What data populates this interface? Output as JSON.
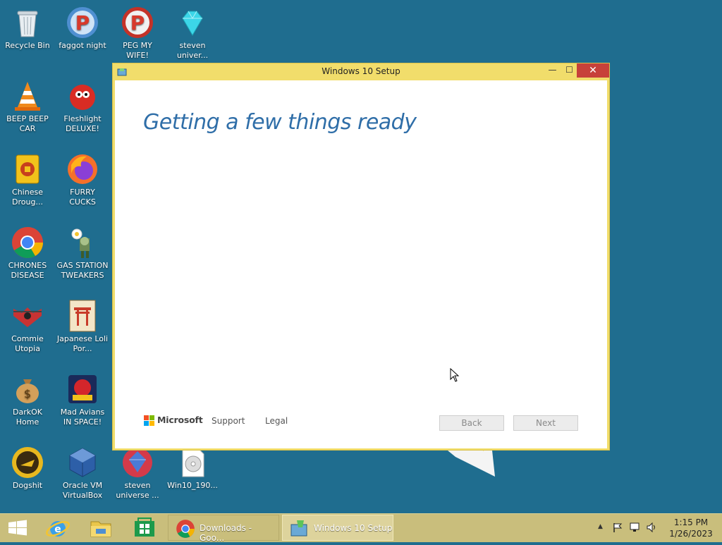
{
  "desktop": {
    "icons": [
      {
        "label": "Recycle Bin"
      },
      {
        "label": "faggot night"
      },
      {
        "label": "PEG MY WIFE!"
      },
      {
        "label": "steven univer..."
      },
      {
        "label": "BEEP BEEP CAR"
      },
      {
        "label": "Fleshlight DELUXE!"
      },
      {
        "label": "Chinese Droug..."
      },
      {
        "label": "FURRY CUCKS"
      },
      {
        "label": "CHRONES DISEASE"
      },
      {
        "label": "GAS STATION TWEAKERS"
      },
      {
        "label": "Commie Utopia"
      },
      {
        "label": "Japanese Loli Por..."
      },
      {
        "label": "DarkOK Home"
      },
      {
        "label": "Mad Avians IN SPACE!"
      },
      {
        "label": "Dogshit"
      },
      {
        "label": "Oracle VM VirtualBox"
      },
      {
        "label": "steven universe ..."
      },
      {
        "label": "Win10_190..."
      }
    ]
  },
  "window": {
    "title": "Windows 10 Setup",
    "minimize": "—",
    "maximize": "☐",
    "close": "✕",
    "heading": "Getting a few things ready",
    "footer": {
      "brand": "Microsoft",
      "support": "Support",
      "legal": "Legal",
      "back": "Back",
      "next": "Next"
    }
  },
  "taskbar": {
    "tasks": [
      {
        "label": "Downloads - Goo..."
      },
      {
        "label": "Windows 10 Setup"
      }
    ],
    "clock": {
      "time": "1:15 PM",
      "date": "1/26/2023"
    },
    "tray_arrow": "▲"
  },
  "colors": {
    "desktop": "#1f6d8f",
    "window_frame": "#f1dd6b",
    "close_button": "#c7413a",
    "heading": "#2f6ea8",
    "taskbar": "#c9be7c"
  }
}
